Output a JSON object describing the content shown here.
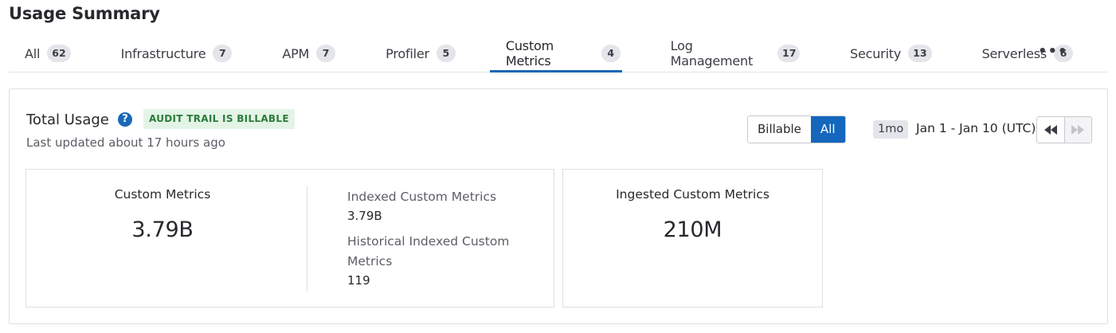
{
  "page": {
    "title": "Usage Summary"
  },
  "tabs": [
    {
      "label": "All",
      "count": "62"
    },
    {
      "label": "Infrastructure",
      "count": "7"
    },
    {
      "label": "APM",
      "count": "7"
    },
    {
      "label": "Profiler",
      "count": "5"
    },
    {
      "label": "Custom Metrics",
      "count": "4"
    },
    {
      "label": "Log Management",
      "count": "17"
    },
    {
      "label": "Security",
      "count": "13"
    },
    {
      "label": "Serverless",
      "count": "6"
    }
  ],
  "active_tab": "Custom Metrics",
  "more_label": "•••",
  "panel": {
    "title": "Total Usage",
    "help_icon": "question-circle-icon",
    "badge": "AUDIT TRAIL IS BILLABLE",
    "last_updated": "Last updated about 17 hours ago",
    "toggle": {
      "billable": "Billable",
      "all": "All",
      "selected": "All"
    },
    "range_chip": "1mo",
    "date_range": "Jan 1 - Jan 10 (UTC)",
    "nav_icons": [
      "rewind-icon",
      "fast-forward-icon"
    ]
  },
  "cards": {
    "custom_metrics": {
      "title": "Custom Metrics",
      "value": "3.79B",
      "indexed_label": "Indexed Custom Metrics",
      "indexed_value": "3.79B",
      "historical_label": "Historical Indexed Custom Metrics",
      "historical_value": "119"
    },
    "ingested": {
      "title": "Ingested Custom Metrics",
      "value": "210M"
    }
  },
  "colors": {
    "accent": "#1967b6",
    "badge_bg": "#e3f4e6",
    "badge_text": "#2d7a3b",
    "count_bg": "#e4e5ea"
  }
}
